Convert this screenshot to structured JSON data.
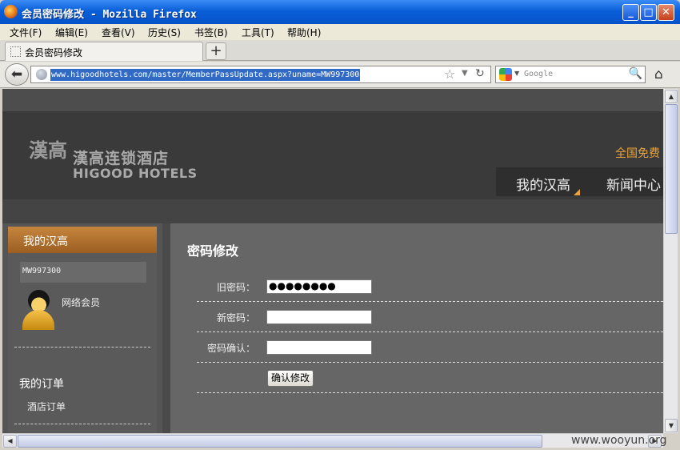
{
  "window": {
    "title": "会员密码修改 - Mozilla Firefox"
  },
  "menu": [
    "文件(F)",
    "编辑(E)",
    "查看(V)",
    "历史(S)",
    "书签(B)",
    "工具(T)",
    "帮助(H)"
  ],
  "tab": {
    "label": "会员密码修改",
    "new_tab": "+"
  },
  "address": {
    "url": "www.higoodhotels.com/master/MemberPassUpdate.aspx?uname=MW997300"
  },
  "search": {
    "placeholder": "Google"
  },
  "site": {
    "logo_cn": "漢高连锁酒店",
    "logo_en": "HIGOOD HOTELS",
    "logo_mark": "漢高",
    "hotline": "全国免费",
    "nav": [
      "我的汉高",
      "新闻中心"
    ]
  },
  "sidebar": {
    "title": "我的汉高",
    "username": "MW997300",
    "member_type": "网络会员",
    "orders_title": "我的订单",
    "orders_link": "酒店订单"
  },
  "form": {
    "title": "密码修改",
    "old_label": "旧密码：",
    "old_value": "●●●●●●●●",
    "new_label": "新密码：",
    "confirm_label": "密码确认：",
    "submit": "确认修改"
  },
  "watermark": "www.wooyun.org"
}
